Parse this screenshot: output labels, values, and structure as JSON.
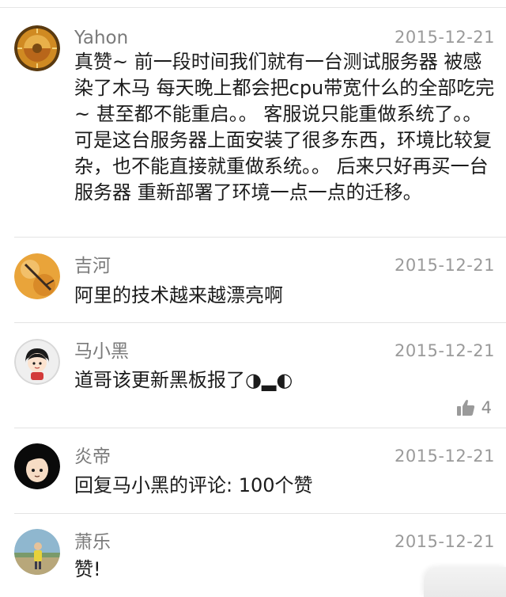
{
  "comments": [
    {
      "name": "Yahon",
      "date": "2015-12-21",
      "text": "真赞~ 前一段时间我们就有一台测试服务器 被感染了木马 每天晚上都会把cpu带宽什么的全部吃完~ 甚至都不能重启。。 客服说只能重做系统了。。可是这台服务器上面安装了很多东西，环境比较复杂，也不能直接就重做系统。。 后来只好再买一台服务器 重新部署了环境一点一点的迁移。"
    },
    {
      "name": "吉河",
      "date": "2015-12-21",
      "text": "阿里的技术越来越漂亮啊"
    },
    {
      "name": "马小黑",
      "date": "2015-12-21",
      "text": "道哥该更新黑板报了◑▂◐",
      "likes": "4"
    },
    {
      "name": "炎帝",
      "date": "2015-12-21",
      "text": "回复马小黑的评论: 100个赞"
    },
    {
      "name": "萧乐",
      "date": "2015-12-21",
      "text": "赞!"
    }
  ],
  "icons": {
    "like": "thumbs-up-icon"
  },
  "colors": {
    "name": "#7a7a7a",
    "date": "#9a9a9a",
    "text": "#1b1b1b",
    "divider": "#e3e3e3"
  }
}
